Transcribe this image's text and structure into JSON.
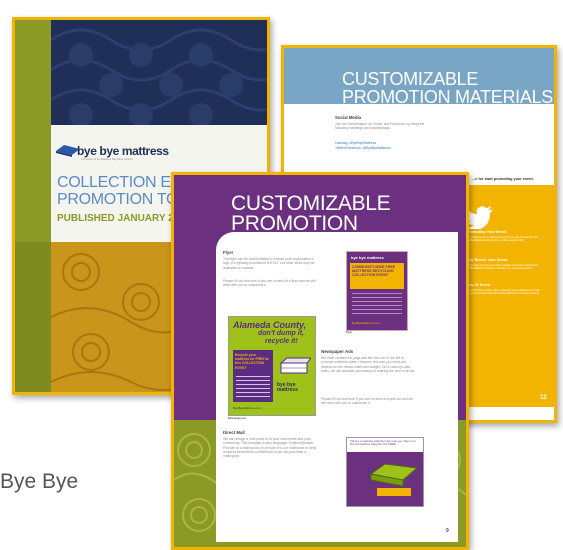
{
  "caption": "Bye Bye",
  "cover": {
    "logo_text": "bye bye mattress",
    "logo_tagline": "A Program of the Mattress Recycling Council",
    "title_line1": "COLLECTION EV",
    "title_line2": "PROMOTION TO",
    "published": "PUBLISHED JANUARY 2"
  },
  "back_page": {
    "title_line1": "CUSTOMIZABLE",
    "title_line2": "PROMOTION MATERIALS",
    "social_heading": "Social Media",
    "social_body": "Join the conversation on Twitter and Facebook by using the following hashtags and handles/tags:",
    "hashtag": "Hashtag: #ByeByeMattress",
    "twitter_handle": "Twitter/Facebook: @ByeByeMattress",
    "start_promo": "...e for start promoting your event.",
    "promo_1_head": "...romoting Your Event",
    "promo_1_body": "...e collecting used mattresses at (you can say for free) the fact ByeByeMattress will recycle it. (date, location, link)",
    "promo_2_head": "...ay Before Your Event",
    "promo_2_body": "Don't forget to bring your used mattress tomorrow to (Program) ByeByeMattress Program will take it for free and recycle it.",
    "promo_3_head": "...ay Of Event",
    "promo_3_body": "Are (or location) today! We're collecting used mattresses for free. They'll be recycled through ByeByeMattress (recruitment photo)",
    "page_num": "12"
  },
  "front_page": {
    "title_line1": "CUSTOMIZABLE",
    "title_line2": "PROMOTION MATERIALS",
    "flyer_heading": "Flyer",
    "flyer_body1": "This flyer can be customizable to include your organization's logo. It's typically provided in 8.5\"x11\" but other sizes may be available on request.",
    "flyer_body2": "Please fill out this form if you are in need of a flyer and we will work with you to customize it.",
    "flyer_thumb_brand": "bye bye mattress",
    "flyer_thumb_title": "COMMUNITY-WIDE FREE MATTRESS RECYCLING COLLECTION EVENT",
    "flyer_thumb_footer": "ByeByeMattress.com",
    "flyer_caption": "Flyer",
    "ad_line1": "Alameda County,",
    "ad_line2": "don't dump it,",
    "ad_line3": "recycle it!",
    "ad_event": "Recycle your mattress for FREE at this COLLECTION EVENT",
    "ad_brand": "bye bye mattress",
    "ad_footer": "ByeByeMattress.com",
    "ad_caption": "Newspaper ad",
    "news_heading": "Newspaper Ads",
    "news_body1": "We have created full-page ads like the one to the left to promote collection sites. However, the size you need will depend on the media outlet and budget. On a case-by-case basis, we will consider purchasing or sharing the cost of an ad.",
    "news_body2": "Please fill out this form if you are in need of a print ad and we will work with you to customize it.",
    "mail_heading": "Direct Mail",
    "mail_body": "We can design a mail piece to fit your mail needs and your community. This template is also language: English/Spanish. Provide us a mailing list (or provide it to our mailhouse to keep recipient information confidential) or we can purchase a mailing list.",
    "mail_thumb_text": "There's a mattress collection site near you. Say no to the old mattress. Recycle it for FREE.",
    "page_num": "9"
  },
  "colors": {
    "olive": "#8b9a26",
    "navy": "#1f2f57",
    "gold": "#c9951a",
    "sky": "#7aa6c6",
    "purple": "#6b3080",
    "yellow_border": "#f2b400",
    "ad_green": "#9fc21a",
    "ad_purple": "#5c2c85"
  }
}
